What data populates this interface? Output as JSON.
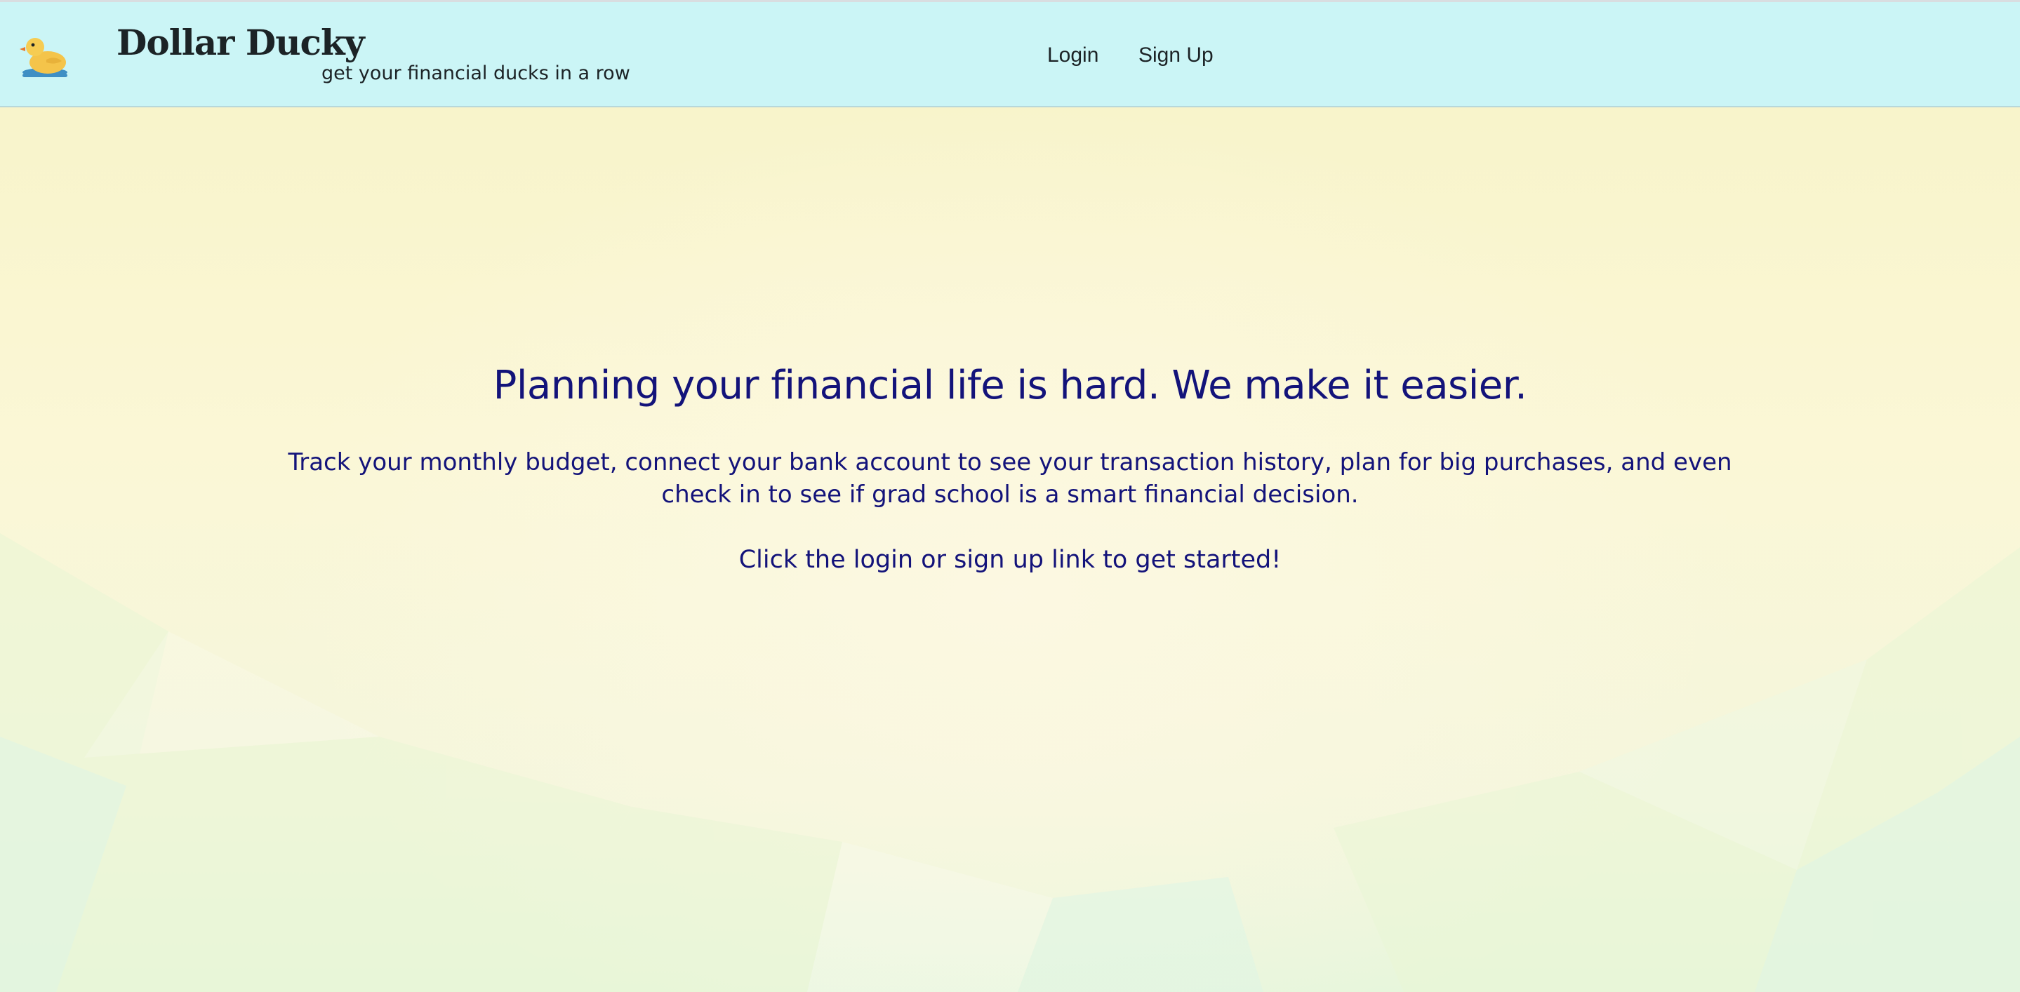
{
  "header": {
    "brand_name": "Dollar Ducky",
    "tagline": "get your financial ducks in a row",
    "logo_icon": "rubber-duck-icon",
    "nav": {
      "login_label": "Login",
      "signup_label": "Sign Up"
    },
    "background_color": "#cbf5f6"
  },
  "hero": {
    "title": "Planning your financial life is hard. We make it easier.",
    "description": "Track your monthly budget, connect your bank account to see your transaction history, plan for big purchases, and even check in to see if grad school is a smart financial decision.",
    "cta_text": "Click the login or sign up link to get started!",
    "text_color": "#13137a"
  },
  "colors": {
    "page_background": "#fbf8dc",
    "accent_green": "#e6f6dc"
  }
}
